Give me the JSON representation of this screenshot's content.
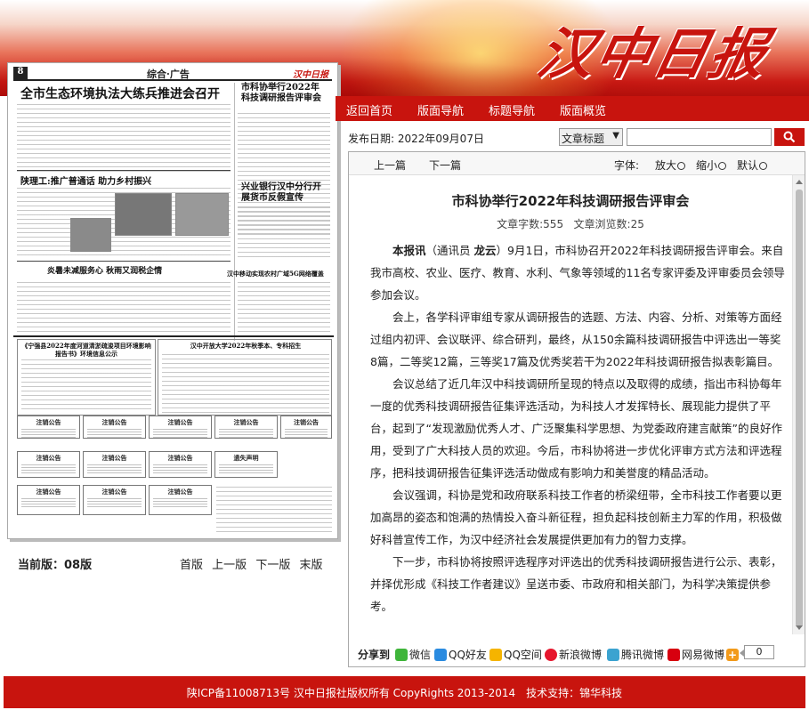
{
  "brand": {
    "logo_text": "汉中日报"
  },
  "nav": {
    "items": [
      "返回首页",
      "版面导航",
      "标题导航",
      "版面概览"
    ]
  },
  "date": {
    "label": "发布日期:",
    "value": "2022年09月07日"
  },
  "search": {
    "type_selected": "文章标题",
    "placeholder": "",
    "button_icon": "search-icon"
  },
  "toolbar": {
    "prev": "上一篇",
    "next": "下一篇",
    "font_label": "字体:",
    "bigger": "放大",
    "smaller": "缩小",
    "default": "默认"
  },
  "article": {
    "title": "市科协举行2022年科技调研报告评审会",
    "word_count_label": "文章字数:",
    "word_count": "555",
    "views_label": "文章浏览数:",
    "views": "25",
    "lead_bold": "本报讯",
    "lead_paren_open": "（通讯员 ",
    "lead_reporter": "龙云",
    "lead_paren_close": "）",
    "p1_rest": "9月1日，市科协召开2022年科技调研报告评审会。来自我市高校、农业、医疗、教育、水利、气象等领域的11名专家评委及评审委员会领导参加会议。",
    "p2": "会上，各学科评审组专家从调研报告的选题、方法、内容、分析、对策等方面经过组内初评、会议联评、综合研判，最终，从150余篇科技调研报告中评选出一等奖8篇，二等奖12篇，三等奖17篇及优秀奖若干为2022年科技调研报告拟表彰篇目。",
    "p3": "会议总结了近几年汉中科技调研所呈现的特点以及取得的成绩，指出市科协每年一度的优秀科技调研报告征集评选活动，为科技人才发挥特长、展现能力提供了平台，起到了“发现激励优秀人才、广泛聚集科学思想、为党委政府建言献策”的良好作用，受到了广大科技人员的欢迎。今后，市科协将进一步优化评审方式方法和评选程序，把科技调研报告征集评选活动做成有影响力和美誉度的精品活动。",
    "p4": "会议强调，科协是党和政府联系科技工作者的桥梁纽带，全市科技工作者要以更加高昂的姿态和饱满的热情投入奋斗新征程，担负起科技创新主力军的作用，积极做好科普宣传工作，为汉中经济社会发展提供更加有力的智力支撑。",
    "p5": "下一步，市科协将按照评选程序对评选出的优秀科技调研报告进行公示、表彰，并择优形成《科技工作者建议》呈送市委、市政府和相关部门，为科学决策提供参考。"
  },
  "share": {
    "label": "分享到",
    "targets": [
      "微信",
      "QQ好友",
      "QQ空间",
      "新浪微博",
      "腾讯微博",
      "网易微博"
    ],
    "count": "0"
  },
  "edition": {
    "current_label": "当前版：08版",
    "first": "首版",
    "prev": "上一版",
    "next": "下一版",
    "last": "末版"
  },
  "thumbnail": {
    "page_num": "8",
    "section": "综合·广告",
    "logo": "汉中日报",
    "headlines": [
      "全市生态环境执法大练兵推进会召开",
      "市科协举行2022年科技调研报告评审会",
      "陕理工:推广普通话 助力乡村振兴",
      "兴业银行汉中分行开展货币反假宣传",
      "炎暑未减服务心 秋雨又润税企情",
      "汉中移动实现农村广域5G网络覆盖",
      "《宁强县2022年度河道清淤疏浚项目环境影响报告书》环境信息公示",
      "汉中开放大学2022年秋季本、专科招生"
    ],
    "notices": [
      "注销公告",
      "注销公告",
      "注销公告",
      "注销公告",
      "注销公告",
      "注销公告",
      "注销公告",
      "遗失声明",
      "注销公告",
      "注销公告",
      "注销公告",
      "注销公告"
    ]
  },
  "footer": {
    "text": "陕ICP备11008713号 汉中日报社版权所有 CopyRights 2013-2014　技术支持：锦华科技"
  },
  "colors": {
    "brand_red": "#c8140e"
  }
}
